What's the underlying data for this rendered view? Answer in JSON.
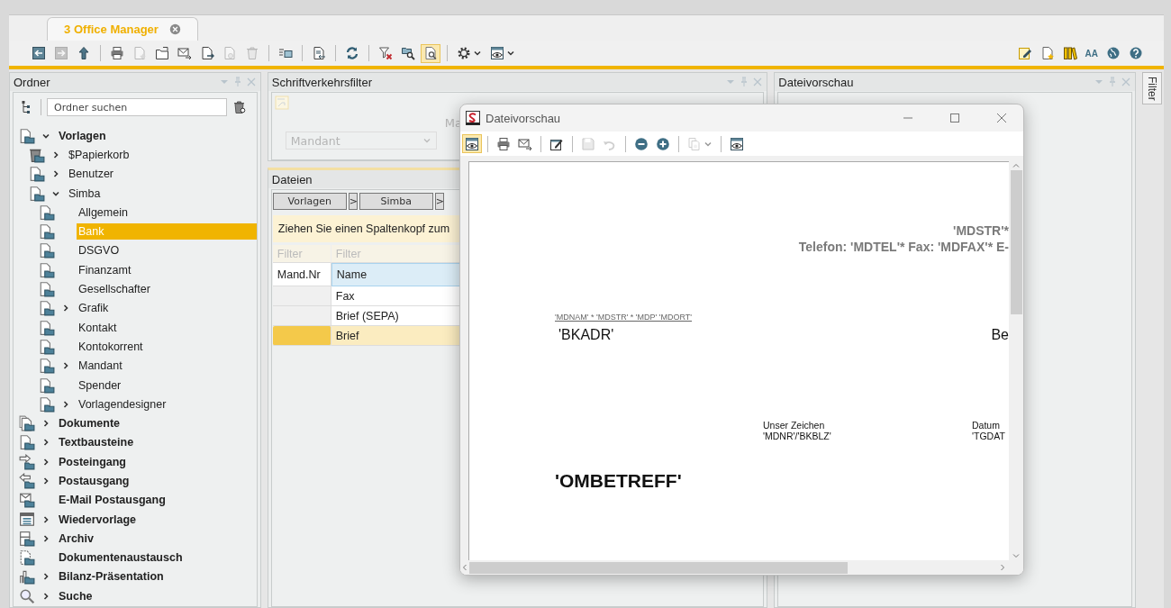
{
  "app_tab": {
    "title": "3 Office Manager"
  },
  "toolbar": [
    {
      "kind": "larrow",
      "disabled": false,
      "selected": false
    },
    {
      "kind": "rarrow",
      "disabled": true,
      "selected": false
    },
    {
      "kind": "up",
      "disabled": false,
      "selected": false
    },
    {
      "kind": "separator"
    },
    {
      "kind": "print",
      "disabled": false,
      "selected": false
    },
    {
      "kind": "docstar",
      "disabled": true,
      "selected": false
    },
    {
      "kind": "folder",
      "disabled": false,
      "selected": false
    },
    {
      "kind": "mail",
      "disabled": false,
      "selected": false
    },
    {
      "kind": "docarrow",
      "disabled": false,
      "selected": false
    },
    {
      "kind": "docclip",
      "disabled": true,
      "selected": false
    },
    {
      "kind": "trash",
      "disabled": true,
      "selected": false
    },
    {
      "kind": "separator"
    },
    {
      "kind": "list",
      "disabled": false,
      "selected": false
    },
    {
      "kind": "separator"
    },
    {
      "kind": "docimport",
      "disabled": false,
      "selected": false
    },
    {
      "kind": "separator"
    },
    {
      "kind": "refresh",
      "disabled": false,
      "selected": false
    },
    {
      "kind": "separator"
    },
    {
      "kind": "filterx",
      "disabled": false,
      "selected": false
    },
    {
      "kind": "foldersearch",
      "disabled": false,
      "selected": false
    },
    {
      "kind": "docsearch",
      "disabled": false,
      "selected": true
    },
    {
      "kind": "separator"
    },
    {
      "kind": "gear",
      "disabled": false,
      "selected": false,
      "dropdown": true
    },
    {
      "kind": "eyewin",
      "disabled": false,
      "selected": false,
      "dropdown": true
    }
  ],
  "toolbar_right": [
    {
      "kind": "edit"
    },
    {
      "kind": "docstar"
    },
    {
      "kind": "books"
    },
    {
      "kind": "font",
      "label": "AA"
    },
    {
      "kind": "globe"
    },
    {
      "kind": "help"
    }
  ],
  "folders": {
    "title": "Ordner",
    "search": {
      "placeholder": "Ordner suchen"
    },
    "tree": [
      {
        "label": "Vorlagen",
        "kind": "tplfolder",
        "expanded": true,
        "selected": false,
        "children": [
          {
            "label": "$Papierkorb",
            "kind": "trashfolder",
            "expanded": false,
            "selected": false
          },
          {
            "label": "Benutzer",
            "kind": "tplfolder",
            "expanded": false,
            "selected": false
          },
          {
            "label": "Simba",
            "kind": "tplfolder",
            "expanded": true,
            "selected": false,
            "children": [
              {
                "label": "Allgemein",
                "kind": "tplfolder",
                "selected": false
              },
              {
                "label": "Bank",
                "kind": "tplfolder",
                "selected": true
              },
              {
                "label": "DSGVO",
                "kind": "tplfolder",
                "selected": false
              },
              {
                "label": "Finanzamt",
                "kind": "tplfolder",
                "selected": false
              },
              {
                "label": "Gesellschafter",
                "kind": "tplfolder",
                "selected": false
              },
              {
                "label": "Grafik",
                "kind": "tplfolder",
                "expanded": false,
                "selected": false
              },
              {
                "label": "Kontakt",
                "kind": "tplfolder",
                "selected": false
              },
              {
                "label": "Kontokorrent",
                "kind": "tplfolder",
                "selected": false
              },
              {
                "label": "Mandant",
                "kind": "tplfolder",
                "expanded": false,
                "selected": false
              },
              {
                "label": "Spender",
                "kind": "tplfolder",
                "selected": false
              },
              {
                "label": "Vorlagendesigner",
                "kind": "tplfolder",
                "expanded": false,
                "selected": false
              }
            ]
          }
        ]
      },
      {
        "label": "Dokumente",
        "kind": "docsfolder",
        "expanded": false,
        "selected": false
      },
      {
        "label": "Textbausteine",
        "kind": "tplfolder",
        "expanded": false,
        "selected": false
      },
      {
        "label": "Posteingang",
        "kind": "inbox",
        "expanded": false,
        "selected": false
      },
      {
        "label": "Postausgang",
        "kind": "outbox",
        "expanded": false,
        "selected": false
      },
      {
        "label": "E-Mail Postausgang",
        "kind": "emailout",
        "selected": false
      },
      {
        "label": "Wiedervorlage",
        "kind": "calendar",
        "expanded": false,
        "selected": false
      },
      {
        "label": "Archiv",
        "kind": "archive",
        "expanded": false,
        "selected": false
      },
      {
        "label": "Dokumentenaustausch",
        "kind": "exchange",
        "selected": false
      },
      {
        "label": "Bilanz-Präsentation",
        "kind": "chart",
        "expanded": false,
        "selected": false
      },
      {
        "label": "Suche",
        "kind": "search",
        "expanded": false,
        "selected": false
      }
    ]
  },
  "filter_panel": {
    "title": "Schriftverkehrsfilter",
    "label": "Ma",
    "select": {
      "value": "Mandant",
      "disabled": true
    }
  },
  "files": {
    "title": "Dateien",
    "breadcrumb": [
      {
        "kind": "crumb",
        "label": "Vorlagen"
      },
      {
        "kind": "separator",
        "label": ">"
      },
      {
        "kind": "crumb",
        "label": "Simba"
      },
      {
        "kind": "separator",
        "label": ">"
      }
    ],
    "group_hint": "Ziehen Sie einen Spaltenkopf zum",
    "filter_row": [
      {
        "placeholder": "Filter"
      },
      {
        "placeholder": "Filter"
      }
    ],
    "columns": [
      "Mand.Nr",
      "Name"
    ],
    "rows": [
      {
        "name": "Fax",
        "selected": false
      },
      {
        "name": "Brief (SEPA)",
        "selected": false
      },
      {
        "name": "Brief",
        "selected": true
      }
    ]
  },
  "preview_panel": {
    "title": "Dateivorschau"
  },
  "side_tab": {
    "label": "Filter"
  },
  "preview_window": {
    "title": "Dateivorschau",
    "toolbar": [
      {
        "kind": "eyewin",
        "disabled": false,
        "selected": true
      },
      {
        "kind": "separator"
      },
      {
        "kind": "print",
        "disabled": false,
        "selected": false
      },
      {
        "kind": "mail",
        "disabled": false,
        "selected": false
      },
      {
        "kind": "separator"
      },
      {
        "kind": "editbox",
        "disabled": false,
        "selected": false
      },
      {
        "kind": "separator"
      },
      {
        "kind": "save",
        "disabled": true,
        "selected": false
      },
      {
        "kind": "undo",
        "disabled": true,
        "selected": false
      },
      {
        "kind": "separator"
      },
      {
        "kind": "minus",
        "disabled": false,
        "selected": false
      },
      {
        "kind": "plus",
        "disabled": false,
        "selected": false
      },
      {
        "kind": "separator"
      },
      {
        "kind": "copy",
        "disabled": true,
        "selected": false,
        "dropdown": true
      },
      {
        "kind": "separator"
      },
      {
        "kind": "eyewin",
        "disabled": false,
        "selected": false
      }
    ],
    "document": [
      {
        "kind": "header_right_1",
        "text": "'MDSTR'*"
      },
      {
        "kind": "header_right_2",
        "text": "Telefon: 'MDTEL'* Fax: 'MDFAX'* E-"
      },
      {
        "kind": "sender_line",
        "text": "'MDNAM' * 'MDSTR' * 'MDP' 'MDORT'"
      },
      {
        "kind": "address",
        "text": "'BKADR'"
      },
      {
        "kind": "address_right",
        "text": "Be"
      },
      {
        "kind": "ref_label",
        "text": "Unser Zeichen"
      },
      {
        "kind": "ref_value",
        "text": "'MDNR'/'BKBLZ'"
      },
      {
        "kind": "date_label",
        "text": "Datum"
      },
      {
        "kind": "date_value",
        "text": "'TGDAT"
      },
      {
        "kind": "subject",
        "text": "'OMBETREFF'"
      }
    ]
  }
}
